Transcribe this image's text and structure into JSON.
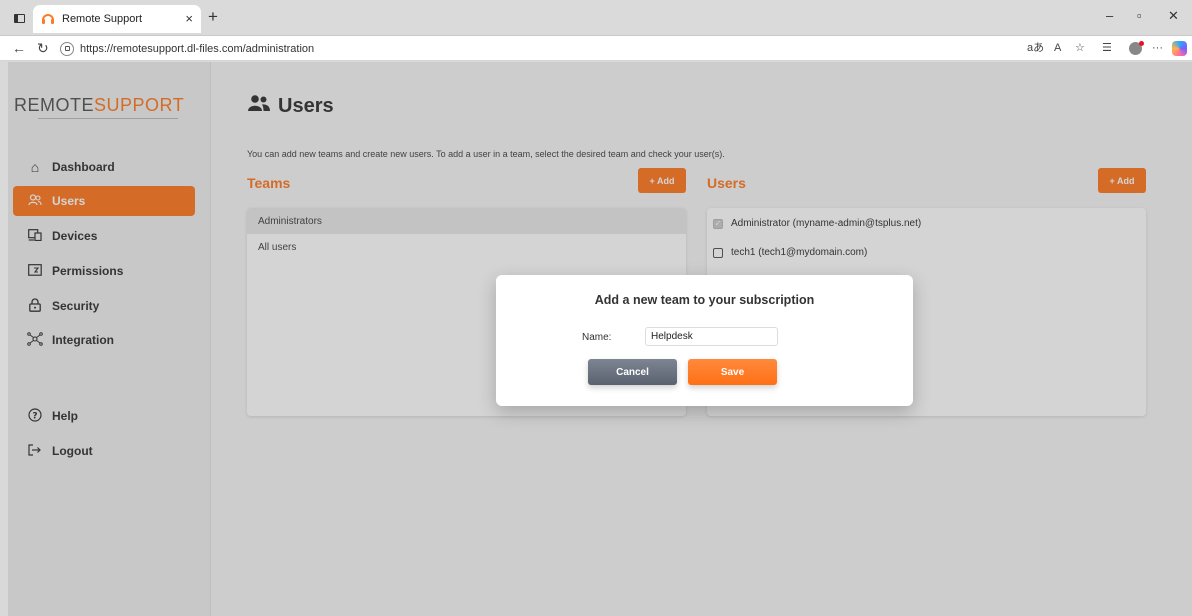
{
  "browser": {
    "tab_title": "Remote Support",
    "new_tab_glyph": "+",
    "close_tab_glyph": "×",
    "url": "https://remotesupport.dl-files.com/administration",
    "window_controls": {
      "minimize": "–",
      "restore": "▫",
      "close": "✕"
    },
    "toolbar_icons": [
      "read-aloud-icon",
      "font-icon",
      "favorite-star-icon",
      "collections-icon",
      "profile-icon",
      "more-icon",
      "copilot-icon"
    ]
  },
  "sidebar": {
    "logo_prefix": "REMOTE",
    "logo_accent": "SUPPORT",
    "items": [
      {
        "label": "Dashboard",
        "icon": "home-icon"
      },
      {
        "label": "Users",
        "icon": "users-icon",
        "active": true
      },
      {
        "label": "Devices",
        "icon": "devices-icon"
      },
      {
        "label": "Permissions",
        "icon": "permissions-icon"
      },
      {
        "label": "Security",
        "icon": "lock-icon"
      },
      {
        "label": "Integration",
        "icon": "integration-icon"
      },
      {
        "label": "Help",
        "icon": "help-icon"
      },
      {
        "label": "Logout",
        "icon": "logout-icon"
      }
    ]
  },
  "main": {
    "title": "Users",
    "intro": "You can add new teams and create new users. To add a user in a team, select the desired team and check your user(s).",
    "teams": {
      "heading": "Teams",
      "add_label": "+ Add",
      "rows": [
        "Administrators",
        "All users"
      ]
    },
    "users": {
      "heading": "Users",
      "add_label": "+ Add",
      "rows": [
        "Administrator (myname-admin@tsplus.net)",
        "tech1 (tech1@mydomain.com)"
      ]
    }
  },
  "modal": {
    "title": "Add a new team to your subscription",
    "name_label": "Name:",
    "name_value": "Helpdesk",
    "cancel_label": "Cancel",
    "save_label": "Save"
  },
  "colors": {
    "accent": "#ff7a22",
    "cancel": "#6b7280",
    "overlay": "#3c3c3c"
  }
}
